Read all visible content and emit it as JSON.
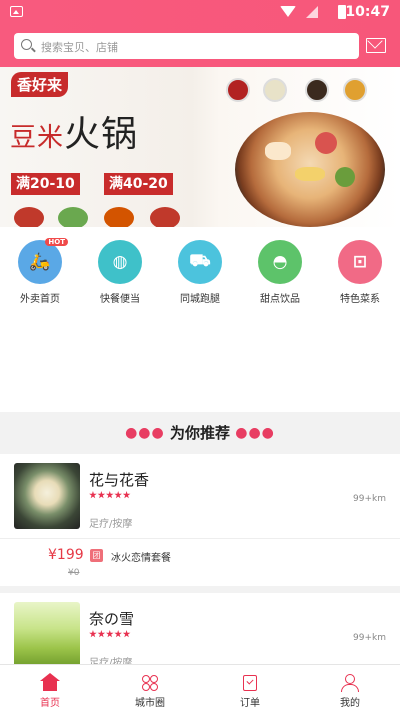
{
  "status_bar": {
    "time": "10:47"
  },
  "search": {
    "placeholder": "搜索宝贝、店铺"
  },
  "banner": {
    "brand": "香好来",
    "title_small": "豆米",
    "title_big": "火锅",
    "promos": [
      "满20-10",
      "满40-20"
    ]
  },
  "categories": [
    {
      "label": "外卖首页",
      "badge": "HOT",
      "color": "#5aa8e6",
      "icon": "scooter-icon"
    },
    {
      "label": "快餐便当",
      "color": "#3fc1c9",
      "icon": "lunchbox-icon"
    },
    {
      "label": "同城跑腿",
      "color": "#4cc3dd",
      "icon": "truck-icon"
    },
    {
      "label": "甜点饮品",
      "color": "#5dc36a",
      "icon": "watermelon-icon"
    },
    {
      "label": "特色菜系",
      "color": "#f16a86",
      "icon": "pot-icon"
    }
  ],
  "section": {
    "title": "为你推荐"
  },
  "stores": [
    {
      "name": "花与花香",
      "rating": 5,
      "distance": "99+km",
      "type": "足疗/按摩",
      "deal": {
        "price": "¥199",
        "original": "¥0",
        "tag": "团",
        "name": "冰火恋情套餐"
      }
    },
    {
      "name": "奈の雪",
      "rating": 5,
      "distance": "99+km",
      "type": "足疗/按摩"
    }
  ],
  "tabs": [
    {
      "label": "首页",
      "active": true,
      "icon": "home-icon"
    },
    {
      "label": "城市圈",
      "active": false,
      "icon": "flower-icon"
    },
    {
      "label": "订单",
      "active": false,
      "icon": "clipboard-icon"
    },
    {
      "label": "我的",
      "active": false,
      "icon": "user-icon"
    }
  ],
  "colors": {
    "brand": "#f7577a",
    "accent": "#e83150",
    "price": "#e63946"
  }
}
